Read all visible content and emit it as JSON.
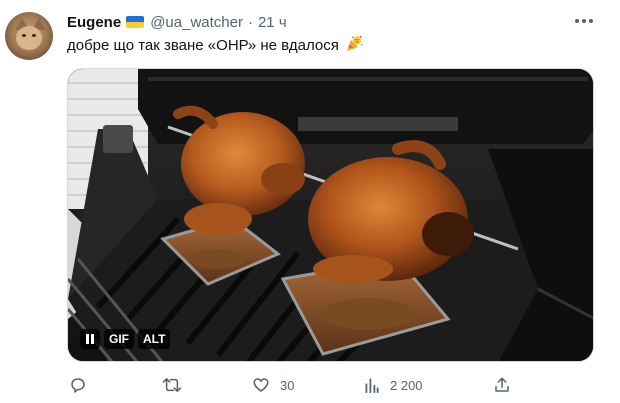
{
  "tweet": {
    "author_name": "Eugene",
    "handle": "@ua_watcher",
    "separator": "·",
    "time": "21 ч",
    "text": "добре що так зване «ОНР» не вдалося",
    "emoji": "partying-face",
    "media": {
      "type": "gif",
      "pause_label": "pause",
      "gif_label": "GIF",
      "alt_label": "ALT",
      "description_icon": "rotisserie-chickens"
    },
    "actions": {
      "reply_count": "",
      "retweet_count": "",
      "like_count": "30",
      "views_count": "2 200"
    },
    "colors": {
      "text": "#0f1419",
      "secondary": "#536471",
      "flag_blue": "#1f6fd6",
      "flag_yellow": "#f7d02c"
    }
  }
}
